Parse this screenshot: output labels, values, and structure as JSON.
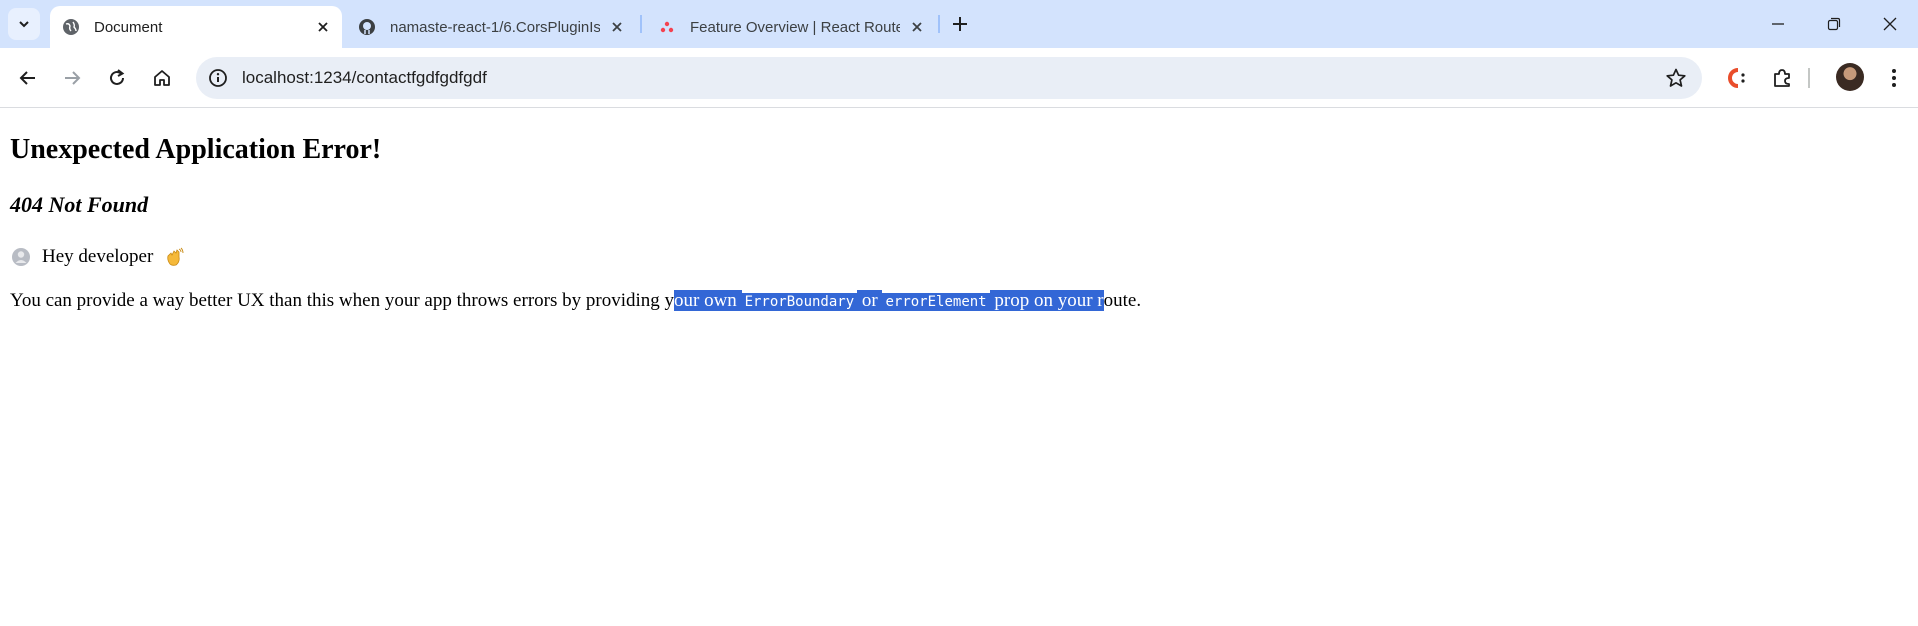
{
  "tabs": [
    {
      "title": "Document",
      "icon": "globe-icon",
      "active": true
    },
    {
      "title": "namaste-react-1/6.CorsPluginIs",
      "icon": "github-icon",
      "active": false
    },
    {
      "title": "Feature Overview | React Router",
      "icon": "react-router-icon",
      "active": false
    }
  ],
  "toolbar": {
    "url": "localhost:1234/contactfgdfgdfgdf"
  },
  "page": {
    "heading": "Unexpected Application Error!",
    "status": "404 Not Found",
    "dev_message": "Hey developer",
    "para_prefix": "You can provide a way better UX than this when your app throws errors by providing y",
    "para_sel1": "our own",
    "code1": "ErrorBoundary",
    "para_or": "or",
    "code2": "errorElement",
    "para_sel2": "prop on your r",
    "para_suffix": "oute."
  },
  "colors": {
    "tabstrip": "#d3e3fd",
    "selection": "#3367d6",
    "omnibox": "#e9eef6"
  }
}
